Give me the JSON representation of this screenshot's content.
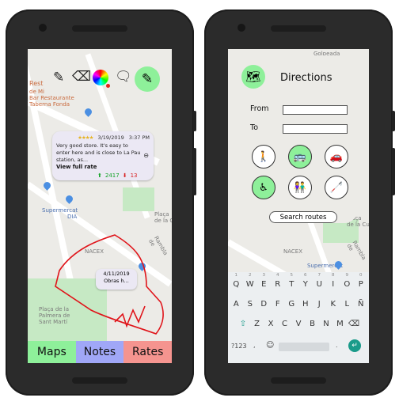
{
  "left_phone": {
    "toolbar": {
      "pencil_icon": "pencil-icon",
      "eraser_icon": "eraser-icon",
      "color_picker_icon": "color-wheel-icon",
      "comment_icon": "comment-icon",
      "edit_icon": "edit-icon"
    },
    "map_labels": {
      "rest": "Rest",
      "rest_address": "de Mi\nBar Restaurante\nTaberna Fonda",
      "supermercat": "Supermercat",
      "dia": "DIA",
      "nacex": "NACEX",
      "plaza_palmera": "Plaça de la\nPalmera de\nSant Martí",
      "placa_cult": "Plaça\nde la Cul",
      "rambla": "Rambla de"
    },
    "note": {
      "stars": "★★★★",
      "date": "3/19/2019",
      "time": "3:37 PM",
      "text": "Very good store. It's easy to enter here and is close to La Pau station, as...",
      "link": "View full rate",
      "upvotes": "2417",
      "downvotes": "13"
    },
    "mini_note": {
      "date": "4/11/2019",
      "text": "Obras h..."
    },
    "tabs": [
      {
        "label": "Maps",
        "color": "#8ef09a"
      },
      {
        "label": "Notes",
        "color": "#a0a7f7"
      },
      {
        "label": "Rates",
        "color": "#f5948f"
      }
    ]
  },
  "right_phone": {
    "map_labels": {
      "top": "Golpeada",
      "nacex": "NACEX",
      "supermercat": "Supermercat",
      "placa_cult": "Plaça\nde la Cul",
      "rambla": "Rambla de"
    },
    "directions": {
      "title": "Directions",
      "from_label": "From",
      "to_label": "To",
      "from_value": "",
      "to_value": "",
      "search_label": "Search routes",
      "modes": [
        {
          "name": "walk",
          "icon": "🚶",
          "active": false
        },
        {
          "name": "bus",
          "icon": "🚌",
          "active": true
        },
        {
          "name": "car",
          "icon": "🚗",
          "active": false
        },
        {
          "name": "wheelchair",
          "icon": "♿",
          "active": true
        },
        {
          "name": "elderly",
          "icon": "👫",
          "active": false
        },
        {
          "name": "blind",
          "icon": "🦯",
          "active": false
        }
      ]
    },
    "keyboard": {
      "row1": [
        "Q",
        "W",
        "E",
        "R",
        "T",
        "Y",
        "U",
        "I",
        "O",
        "P"
      ],
      "row1_nums": [
        "1",
        "2",
        "3",
        "4",
        "5",
        "6",
        "7",
        "8",
        "9",
        "0"
      ],
      "row2": [
        "A",
        "S",
        "D",
        "F",
        "G",
        "H",
        "J",
        "K",
        "L",
        "Ñ"
      ],
      "row3": [
        "Z",
        "X",
        "C",
        "V",
        "B",
        "N",
        "M"
      ],
      "shift": "⇧",
      "backspace": "⌫",
      "sym": "?123",
      "comma": ",",
      "emoji": "☺",
      "period": ".",
      "enter": "↵"
    }
  }
}
